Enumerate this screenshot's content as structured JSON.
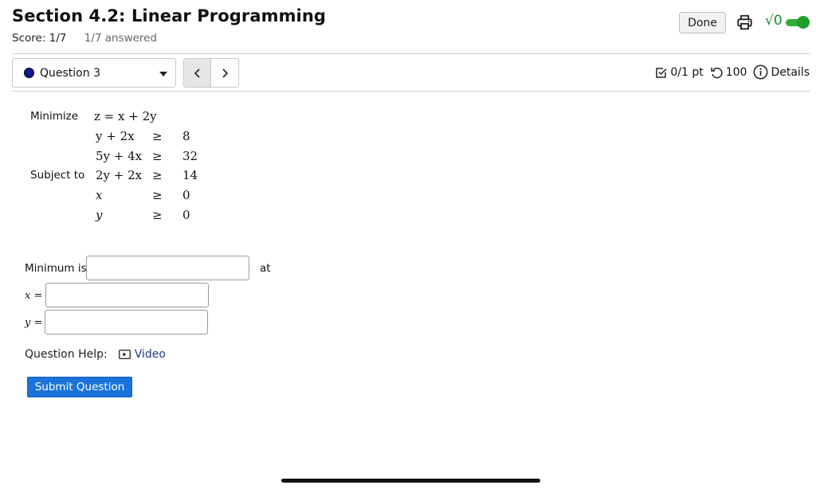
{
  "header": {
    "title": "Section 4.2: Linear Programming",
    "score": "Score: 1/7",
    "answered": "1/7 answered",
    "done_label": "Done",
    "math_toggle_glyph": "√0"
  },
  "nav": {
    "question_label": "Question 3",
    "prev_glyph": "‹",
    "next_glyph": "›"
  },
  "meta": {
    "points": "0/1 pt",
    "attempts": "100",
    "details": "Details"
  },
  "problem": {
    "minimize_label": "Minimize",
    "subject_to_label": "Subject to",
    "objective": "z = x + 2y",
    "constraints": [
      {
        "lhs": "y + 2x",
        "op": "≥",
        "rhs": "8"
      },
      {
        "lhs": "5y + 4x",
        "op": "≥",
        "rhs": "32"
      },
      {
        "lhs": "2y + 2x",
        "op": "≥",
        "rhs": "14"
      },
      {
        "lhs": "x",
        "op": "≥",
        "rhs": "0"
      },
      {
        "lhs": "y",
        "op": "≥",
        "rhs": "0"
      }
    ]
  },
  "answer": {
    "minimum_label": "Minimum is",
    "at_label": "at",
    "x_label": "x =",
    "y_label": "y =",
    "minimum_value": "",
    "x_value": "",
    "y_value": ""
  },
  "help": {
    "label": "Question Help:",
    "video_label": "Video"
  },
  "submit_label": "Submit Question",
  "colors": {
    "accent": "#1a73d9",
    "toggle_green": "#2fae3a",
    "link": "#1f3a8a"
  }
}
